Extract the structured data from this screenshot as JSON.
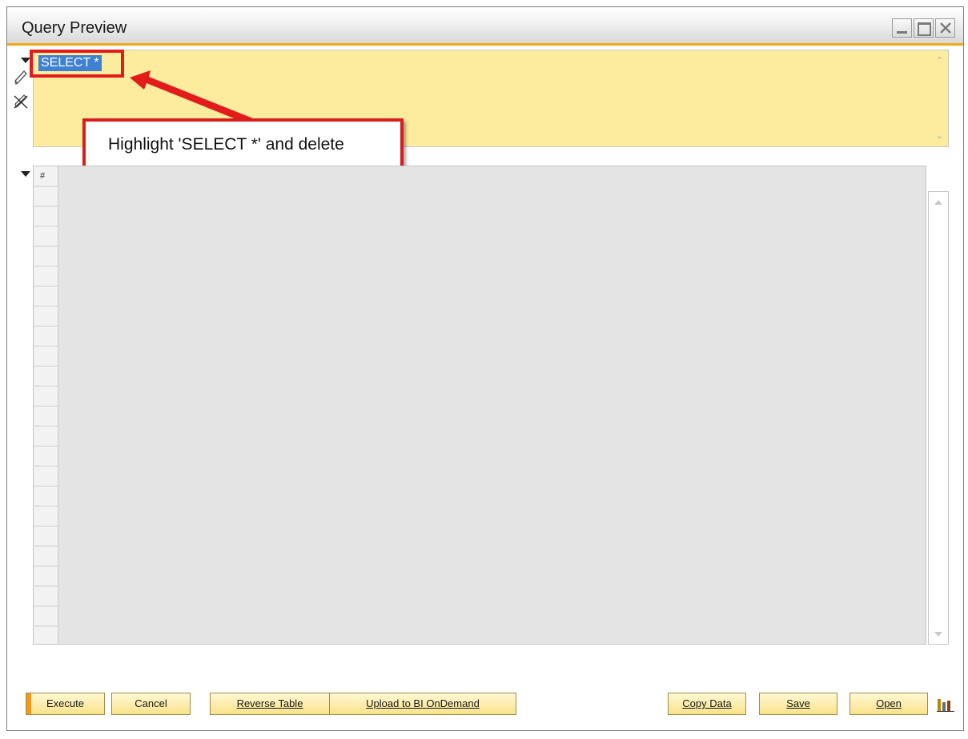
{
  "window": {
    "title": "Query Preview",
    "controls": [
      "minimize",
      "maximize",
      "close"
    ]
  },
  "query": {
    "text": "SELECT *",
    "icons": [
      "collapse-arrow-icon",
      "pencil-icon",
      "eraser-icon"
    ]
  },
  "annotation": {
    "callout_text": "Highlight 'SELECT *' and delete"
  },
  "grid": {
    "header_label": "#"
  },
  "buttons": {
    "execute": "Execute",
    "cancel": "Cancel",
    "reverse_table": "Reverse Table",
    "upload": "Upload to BI OnDemand",
    "copy_data": "Copy Data",
    "save": "Save",
    "open": "Open"
  },
  "colors": {
    "query_background": "#fdec9d",
    "selection": "#3e80d2",
    "button_face": "#f8e38a",
    "title_accent": "#f0a818",
    "annotation_red": "#d81d1d"
  }
}
